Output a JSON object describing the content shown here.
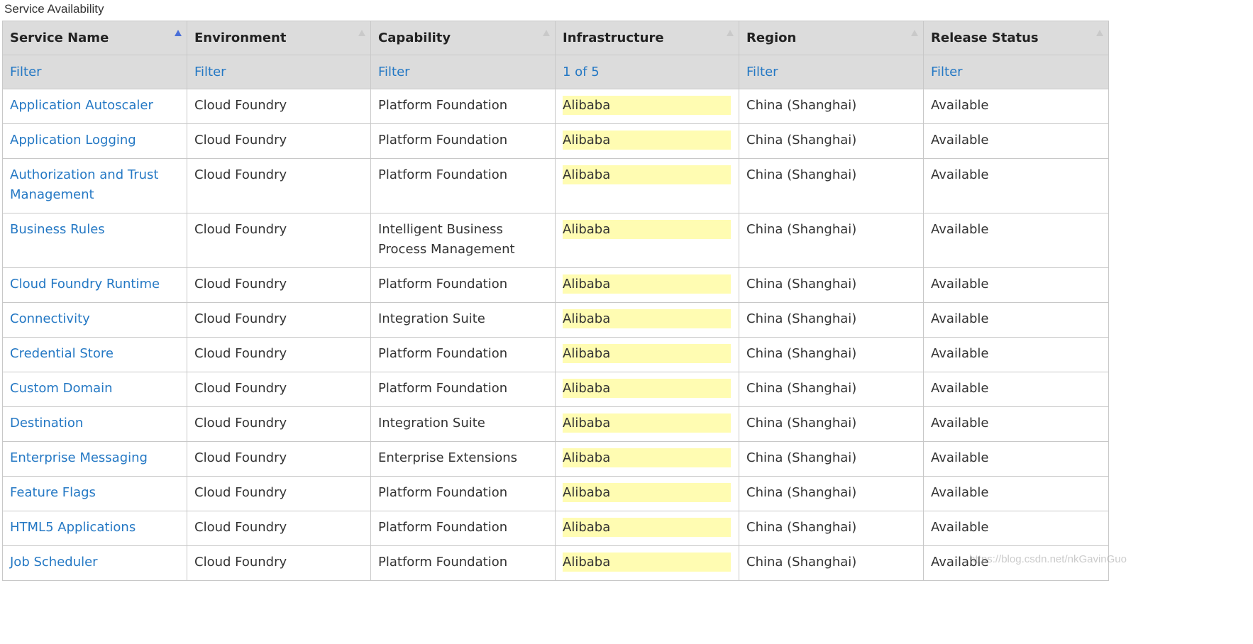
{
  "caption": "Service Availability",
  "columns": [
    {
      "label": "Service Name",
      "filter": "Filter"
    },
    {
      "label": "Environment",
      "filter": "Filter"
    },
    {
      "label": "Capability",
      "filter": "Filter"
    },
    {
      "label": "Infrastructure",
      "filter": "1 of 5"
    },
    {
      "label": "Region",
      "filter": "Filter"
    },
    {
      "label": "Release Status",
      "filter": "Filter"
    }
  ],
  "sort": {
    "column": "Service Name",
    "direction": "ascending",
    "icon": "sort-ascending-icon"
  },
  "colors": {
    "link": "#2478c4",
    "header_bg": "#dcdcdc",
    "infra_highlight": "#fffcb2",
    "sort_active": "#4a6fd8"
  },
  "rows": [
    {
      "service": "Application Autoscaler",
      "environment": "Cloud Foundry",
      "capability": "Platform Foundation",
      "infrastructure": "Alibaba",
      "region": "China (Shanghai)",
      "status": "Available"
    },
    {
      "service": "Application Logging",
      "environment": "Cloud Foundry",
      "capability": "Platform Foundation",
      "infrastructure": "Alibaba",
      "region": "China (Shanghai)",
      "status": "Available"
    },
    {
      "service": "Authorization and Trust Management",
      "environment": "Cloud Foundry",
      "capability": "Platform Foundation",
      "infrastructure": "Alibaba",
      "region": "China (Shanghai)",
      "status": "Available"
    },
    {
      "service": "Business Rules",
      "environment": "Cloud Foundry",
      "capability": "Intelligent Business Process Management",
      "infrastructure": "Alibaba",
      "region": "China (Shanghai)",
      "status": "Available"
    },
    {
      "service": "Cloud Foundry Runtime",
      "environment": "Cloud Foundry",
      "capability": "Platform Foundation",
      "infrastructure": "Alibaba",
      "region": "China (Shanghai)",
      "status": "Available"
    },
    {
      "service": "Connectivity",
      "environment": "Cloud Foundry",
      "capability": "Integration Suite",
      "infrastructure": "Alibaba",
      "region": "China (Shanghai)",
      "status": "Available"
    },
    {
      "service": "Credential Store",
      "environment": "Cloud Foundry",
      "capability": "Platform Foundation",
      "infrastructure": "Alibaba",
      "region": "China (Shanghai)",
      "status": "Available"
    },
    {
      "service": "Custom Domain",
      "environment": "Cloud Foundry",
      "capability": "Platform Foundation",
      "infrastructure": "Alibaba",
      "region": "China (Shanghai)",
      "status": "Available"
    },
    {
      "service": "Destination",
      "environment": "Cloud Foundry",
      "capability": "Integration Suite",
      "infrastructure": "Alibaba",
      "region": "China (Shanghai)",
      "status": "Available"
    },
    {
      "service": "Enterprise Messaging",
      "environment": "Cloud Foundry",
      "capability": "Enterprise Extensions",
      "infrastructure": "Alibaba",
      "region": "China (Shanghai)",
      "status": "Available"
    },
    {
      "service": "Feature Flags",
      "environment": "Cloud Foundry",
      "capability": "Platform Foundation",
      "infrastructure": "Alibaba",
      "region": "China (Shanghai)",
      "status": "Available"
    },
    {
      "service": "HTML5 Applications",
      "environment": "Cloud Foundry",
      "capability": "Platform Foundation",
      "infrastructure": "Alibaba",
      "region": "China (Shanghai)",
      "status": "Available"
    },
    {
      "service": "Job Scheduler",
      "environment": "Cloud Foundry",
      "capability": "Platform Foundation",
      "infrastructure": "Alibaba",
      "region": "China (Shanghai)",
      "status": "Available"
    }
  ],
  "watermark": "https://blog.csdn.net/nkGavinGuo"
}
